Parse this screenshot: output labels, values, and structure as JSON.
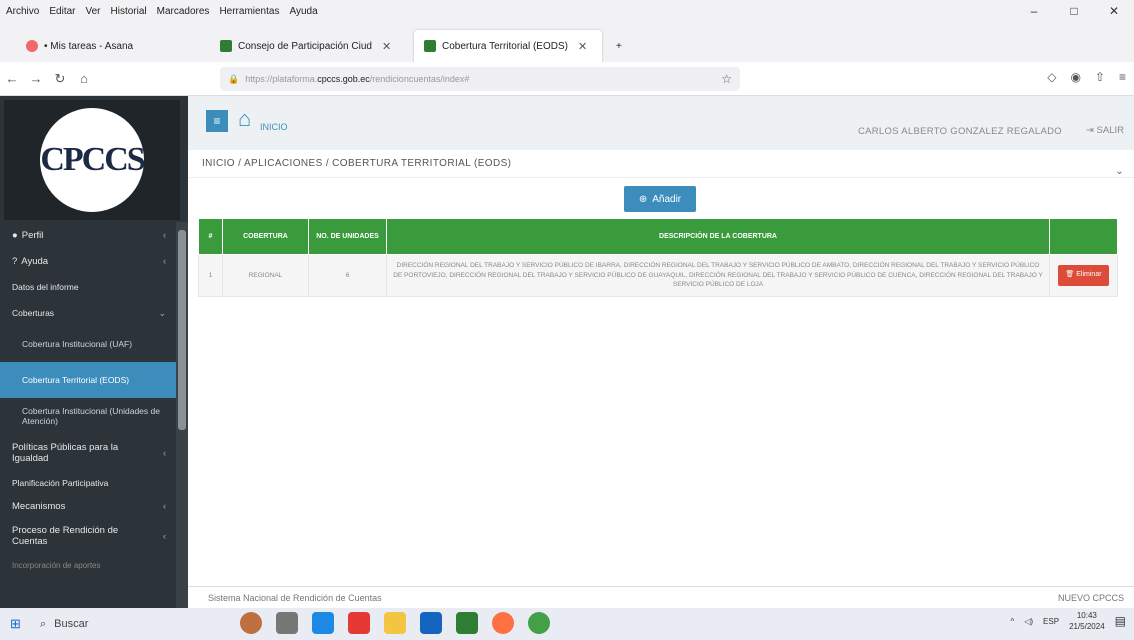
{
  "menubar": {
    "items": [
      "Archivo",
      "Editar",
      "Ver",
      "Historial",
      "Marcadores",
      "Herramientas",
      "Ayuda"
    ]
  },
  "tabs": [
    {
      "label": "• Mis tareas - Asana",
      "color": "#f06a6a"
    },
    {
      "label": "Consejo de Participación Ciud",
      "color": "#2e7d32"
    },
    {
      "label": "Cobertura Territorial (EODS)",
      "color": "#2e7d32"
    }
  ],
  "url": {
    "prefix": "https://plataforma.",
    "domain": "cpccs.gob.ec",
    "path": "/rendicioncuentas/index#"
  },
  "sidebar": {
    "logo_text": "CPCCS",
    "items": [
      {
        "label": "Perfil",
        "chevron": true
      },
      {
        "label": "Ayuda",
        "chevron": true
      },
      {
        "label": "Datos del informe",
        "chevron": false
      },
      {
        "label": "Coberturas",
        "chevron": true
      },
      {
        "label": "Cobertura Institucional (UAF)",
        "chevron": false
      },
      {
        "label": "Cobertura Territorial (EODS)",
        "chevron": false
      },
      {
        "label": "Cobertura Institucional (Unidades de Atención)",
        "chevron": false
      },
      {
        "label": "Políticas Públicas para la Igualdad",
        "chevron": true
      },
      {
        "label": "Planificación Participativa",
        "chevron": false
      },
      {
        "label": "Mecanismos",
        "chevron": true
      },
      {
        "label": "Proceso de Rendición de Cuentas",
        "chevron": true
      },
      {
        "label": "Incorporación de aportes",
        "chevron": false
      }
    ]
  },
  "topbar": {
    "home_label": "INICIO",
    "user": "CARLOS ALBERTO GONZALEZ REGALADO",
    "logout": "SALIR"
  },
  "breadcrumb": "INICIO / APLICACIONES / COBERTURA TERRITORIAL (EODS)",
  "add_button": "Añadir",
  "table": {
    "headers": [
      "#",
      "COBERTURA",
      "NO. DE UNIDADES",
      "DESCRIPCIÓN DE LA COBERTURA",
      ""
    ],
    "rows": [
      {
        "num": "1",
        "cobertura": "REGIONAL",
        "unidades": "6",
        "descripcion": "DIRECCIÓN REGIONAL DEL TRABAJO Y SERVICIO PÚBLICO DE IBARRA, DIRECCIÓN REGIONAL DEL TRABAJO Y SERVICIO PÚBLICO DE AMBATO, DIRECCIÓN REGIONAL DEL TRABAJO Y SERVICIO PÚBLICO DE PORTOVIEJO, DIRECCIÓN REGIONAL DEL TRABAJO Y SERVICIO PÚBLICO DE GUAYAQUIL, DIRECCIÓN REGIONAL DEL TRABAJO Y SERVICIO PÚBLICO DE CUENCA, DIRECCIÓN REGIONAL DEL TRABAJO Y SERVICIO PÚBLICO DE LOJA",
        "action": "Eliminar"
      }
    ]
  },
  "footer": {
    "left": "Sistema Nacional de Rendición de Cuentas",
    "right": "NUEVO CPCCS"
  },
  "taskbar": {
    "search": "Buscar",
    "time": "10:43",
    "date": "21/5/2024",
    "lang": "ESP"
  }
}
